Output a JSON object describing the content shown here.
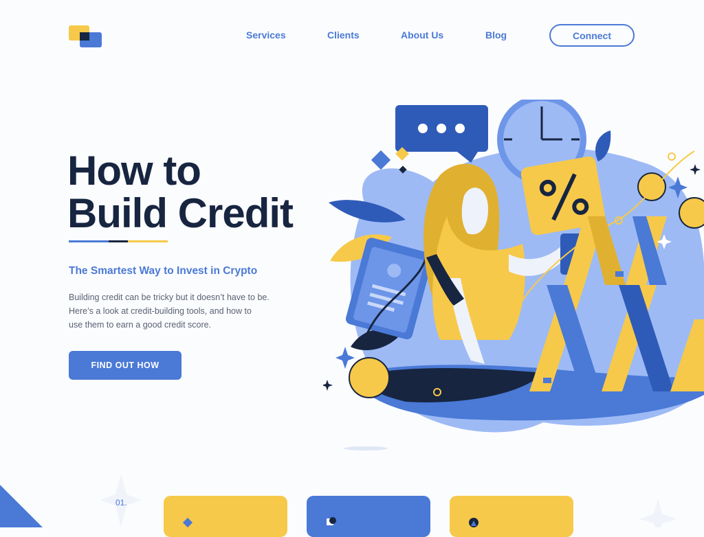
{
  "header": {
    "nav": [
      {
        "label": "Services"
      },
      {
        "label": "Clients"
      },
      {
        "label": "About Us"
      },
      {
        "label": "Blog"
      }
    ],
    "connect_label": "Connect"
  },
  "hero": {
    "title_line1": "How to",
    "title_line2": "Build Credit",
    "subtitle": "The Smartest Way to Invest in Crypto",
    "desc_line1": "Building credit can be tricky but it doesn’t have to be.",
    "desc_line2": "Here’s a look at credit-building tools, and how to",
    "desc_line3": "use them to earn a good credit score.",
    "cta_label": "FIND OUT HOW"
  },
  "features": {
    "number": "01."
  },
  "colors": {
    "primary": "#4a79d6",
    "navy": "#172540",
    "yellow": "#f7c94a",
    "light_blue": "#9dbaf5"
  }
}
